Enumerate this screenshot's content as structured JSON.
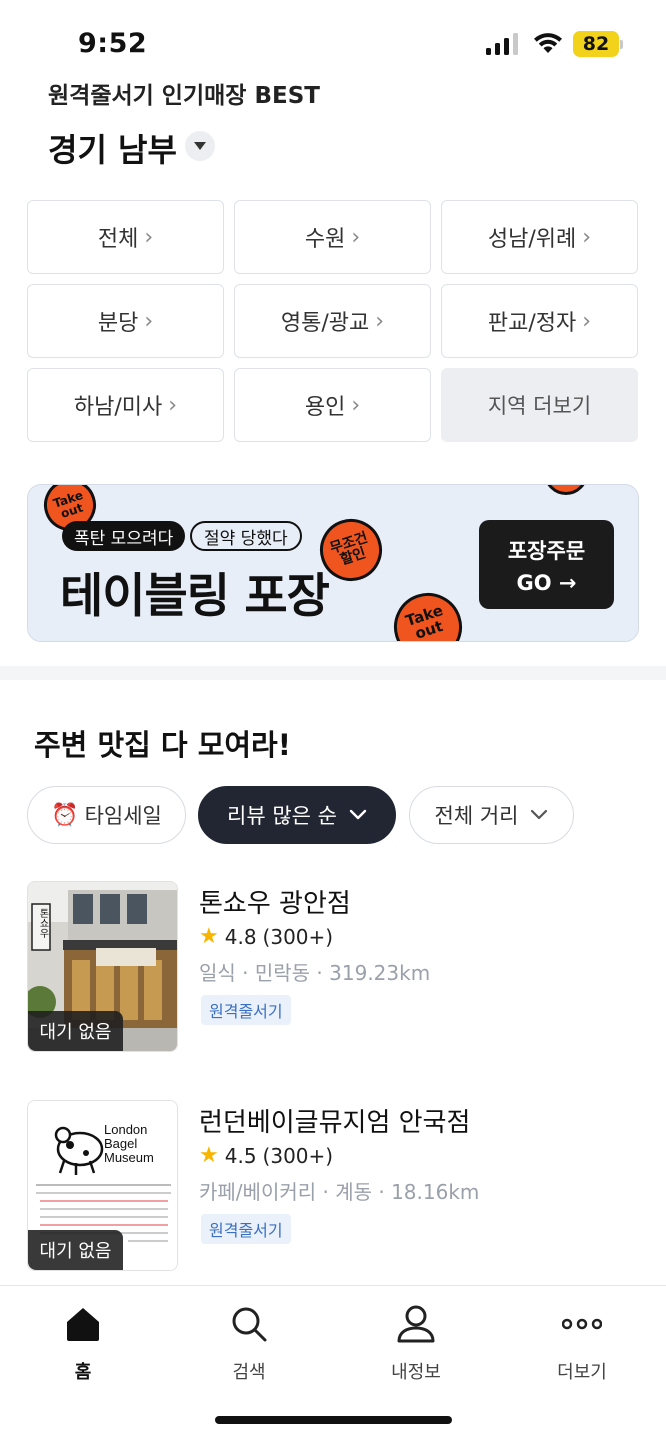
{
  "status_bar": {
    "time": "9:52",
    "battery": "82"
  },
  "header": {
    "subtitle": "원격줄서기 인기매장 BEST",
    "region": "경기 남부"
  },
  "regions": [
    {
      "label": "전체",
      "chevron": true
    },
    {
      "label": "수원",
      "chevron": true
    },
    {
      "label": "성남/위례",
      "chevron": true
    },
    {
      "label": "분당",
      "chevron": true
    },
    {
      "label": "영통/광교",
      "chevron": true
    },
    {
      "label": "판교/정자",
      "chevron": true
    },
    {
      "label": "하남/미사",
      "chevron": true
    },
    {
      "label": "용인",
      "chevron": true
    },
    {
      "label": "지역 더보기",
      "chevron": false
    }
  ],
  "banner": {
    "sticker_takeout": "Take out",
    "sticker_discount": "무조건 할인",
    "tag_a": "폭탄 모으려다",
    "tag_b": "절약 당했다",
    "headline": "테이블링 포장",
    "cta_line1": "포장주문",
    "cta_line2": "GO →"
  },
  "restaurants_section": {
    "title": "주변 맛집 다 모여라!",
    "filters": {
      "timesale": "타임세일",
      "sort": "리뷰 많은 순",
      "distance": "전체 거리"
    },
    "items": [
      {
        "name": "톤쇼우 광안점",
        "rating": "4.8",
        "reviews": "(300+)",
        "meta": "일식 · 민락동 · 319.23km",
        "tag": "원격줄서기",
        "badge": "대기 없음",
        "sign_text": "톤쇼우"
      },
      {
        "name": "런던베이글뮤지엄 안국점",
        "rating": "4.5",
        "reviews": "(300+)",
        "meta": "카페/베이커리 · 계동 · 18.16km",
        "tag": "원격줄서기",
        "badge": "대기 없음",
        "logo_text": [
          "London",
          "Bagel",
          "Museum"
        ]
      }
    ]
  },
  "bottom_nav": [
    {
      "label": "홈",
      "icon": "home-icon",
      "active": true
    },
    {
      "label": "검색",
      "icon": "search-icon",
      "active": false
    },
    {
      "label": "내정보",
      "icon": "person-icon",
      "active": false
    },
    {
      "label": "더보기",
      "icon": "more-dots-icon",
      "active": false
    }
  ],
  "colors": {
    "accent_dark": "#212632",
    "sticker_orange": "#f0551f",
    "banner_bg": "#e8eef8",
    "tag_blue": "#3a6fc4",
    "star": "#f7b500",
    "battery": "#f2d21b"
  }
}
